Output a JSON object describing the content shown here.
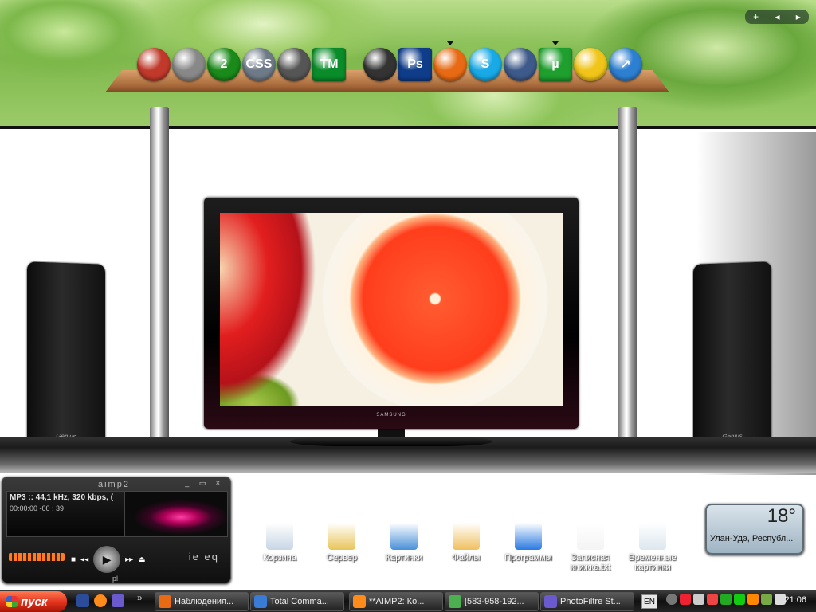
{
  "dock": {
    "items": [
      {
        "name": "app-1",
        "color": "#c0392b"
      },
      {
        "name": "app-2",
        "color": "#888888"
      },
      {
        "name": "half-life-2",
        "glyph": "2",
        "color": "#1a8a1a"
      },
      {
        "name": "counter-strike-source",
        "glyph": "CSS",
        "color": "#6e7a88"
      },
      {
        "name": "app-5",
        "color": "#555555"
      },
      {
        "name": "trackmania",
        "glyph": "TM",
        "color": "#0a8c2a"
      },
      {
        "name": "camera",
        "color": "#333333"
      },
      {
        "name": "photoshop",
        "glyph": "Ps",
        "color": "#0f3d8a"
      },
      {
        "name": "firefox",
        "color": "#e86a14"
      },
      {
        "name": "skype",
        "glyph": "S",
        "color": "#18a9e6"
      },
      {
        "name": "app-11",
        "color": "#3e5a8a"
      },
      {
        "name": "utorrent",
        "glyph": "µ",
        "color": "#1e9f2e"
      },
      {
        "name": "app-13",
        "color": "#f0c419"
      },
      {
        "name": "app-14",
        "glyph": "↗",
        "color": "#2d7fd1"
      }
    ],
    "controls": [
      "+",
      "◂",
      "▸"
    ]
  },
  "aimp": {
    "logo": "aimp2",
    "window_buttons": "_ ▭ ×",
    "info_line": "MP3 :: 44,1 kHz, 320 kbps, (",
    "time": "00:00:00  -00 : 39",
    "play": "▶",
    "prev": "◂◂",
    "stop": "■",
    "next": "▸▸",
    "eject": "⏏",
    "playlist_tag": "pl",
    "eq_label": "ie eq"
  },
  "desktop_icons": [
    {
      "label": "Корзина",
      "color": "#c8d6e5"
    },
    {
      "label": "Сервер",
      "color": "#e8c55a"
    },
    {
      "label": "Картинки",
      "color": "#4a90d9"
    },
    {
      "label": "Файлы",
      "color": "#f0c060"
    },
    {
      "label": "Программы",
      "color": "#2a7ae2"
    },
    {
      "label": "Записная книжка.txt",
      "color": "#f4f4f4"
    },
    {
      "label": "Временные картинки",
      "color": "#dde7ef"
    }
  ],
  "weather": {
    "temp": "18°",
    "location": "Улан-Удэ, Республ..."
  },
  "taskbar": {
    "start_label": "пуск",
    "tasks": [
      {
        "label": "Наблюдения...",
        "color": "#e86a14"
      },
      {
        "label": "Total Comma...",
        "color": "#3a7bd5"
      },
      {
        "label": "**AIMP2: Ко...",
        "color": "#ff8c1a"
      },
      {
        "label": "[583-958-192...",
        "color": "#4caf50"
      },
      {
        "label": "PhotoFiltre St...",
        "color": "#6a5acd"
      }
    ],
    "lang": "EN",
    "clock": "21:06"
  },
  "tv": {
    "brand": "SAMSUNG"
  },
  "speaker_brand": "Genius"
}
